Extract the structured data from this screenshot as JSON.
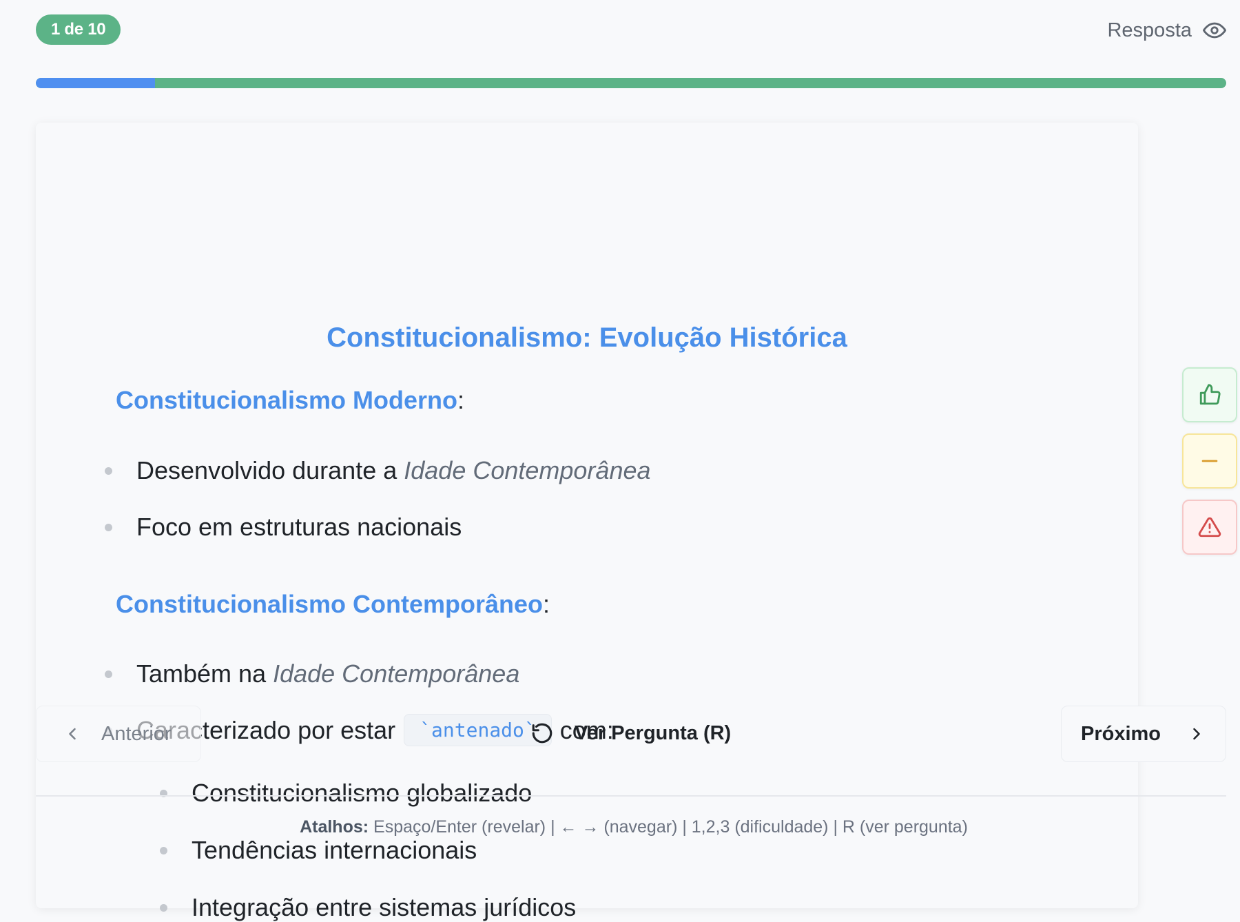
{
  "header": {
    "counter": "1 de 10",
    "answer_toggle_label": "Resposta",
    "progress_fraction": 0.1
  },
  "card": {
    "title": "Constitucionalismo: Evolução Histórica",
    "sections": [
      {
        "heading": "Constitucionalismo Moderno",
        "bullets": [
          {
            "text": "Desenvolvido durante a",
            "emphasis": "Idade Contemporânea"
          },
          {
            "text": "Foco em estruturas nacionais"
          }
        ]
      },
      {
        "heading": "Constitucionalismo Contemporâneo",
        "bullets": [
          {
            "text": "Também na",
            "emphasis": "Idade Contemporânea"
          },
          {
            "text_before": "Caracterizado por estar",
            "code": "`antenado`",
            "text_after": "com:"
          }
        ],
        "sub_bullets": [
          "Constitucionalismo globalizado",
          "Tendências internacionais",
          "Integração entre sistemas jurídicos"
        ]
      }
    ],
    "colon": ":"
  },
  "navigation": {
    "prev_label": "Anterior",
    "question_label": "Ver Pergunta (R)",
    "next_label": "Próximo"
  },
  "shortcuts": {
    "prefix": "Atalhos:",
    "text": " Espaço/Enter (revelar) | ← → (navegar) | 1,2,3 (dificuldade) | R (ver pergunta)"
  },
  "rating_buttons": [
    {
      "icon": "thumbs-up-icon",
      "color": "#3f9a5a"
    },
    {
      "icon": "minus-icon",
      "color": "#d99a2b"
    },
    {
      "icon": "warning-icon",
      "color": "#d44b4b"
    }
  ],
  "colors": {
    "accent_blue": "#4a8fe9",
    "accent_green": "#5cb387"
  }
}
